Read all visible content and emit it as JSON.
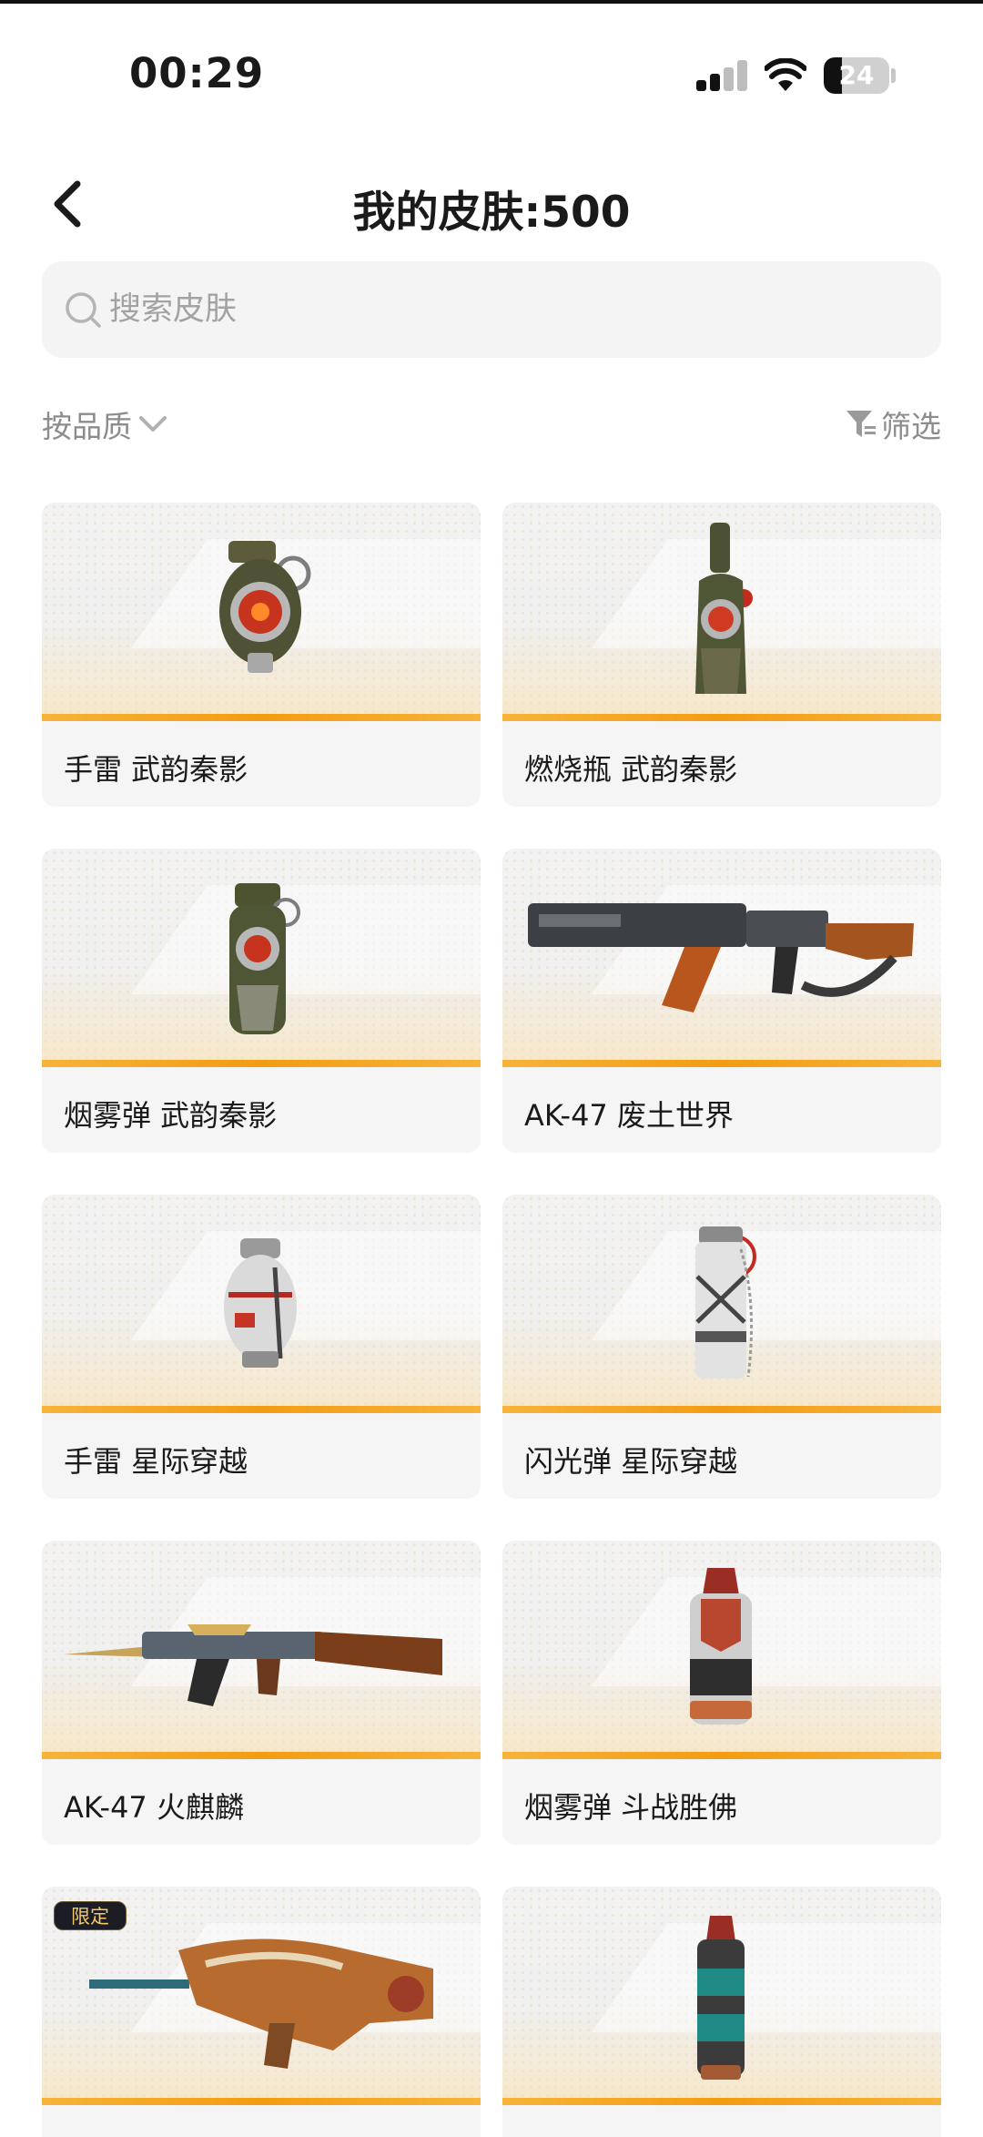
{
  "status_bar": {
    "time": "00:29",
    "battery": "24"
  },
  "header": {
    "title": "我的皮肤:500"
  },
  "search": {
    "placeholder": "搜索皮肤"
  },
  "toolbar": {
    "sort_label": "按品质",
    "filter_label": "筛选"
  },
  "colors": {
    "accent_bar": "#f39c12",
    "card_bg": "#f5f5f5",
    "badge_text": "#f2c96a"
  },
  "skins": [
    {
      "name": "手雷 武韵秦影",
      "icon": "grenade-icon"
    },
    {
      "name": "燃烧瓶 武韵秦影",
      "icon": "molotov-icon"
    },
    {
      "name": "烟雾弹 武韵秦影",
      "icon": "smoke-grenade-icon"
    },
    {
      "name": "AK-47 废土世界",
      "icon": "rifle-icon"
    },
    {
      "name": "手雷 星际穿越",
      "icon": "grenade-icon"
    },
    {
      "name": "闪光弹 星际穿越",
      "icon": "flashbang-icon"
    },
    {
      "name": "AK-47 火麒麟",
      "icon": "rifle-icon"
    },
    {
      "name": "烟雾弹 斗战胜佛",
      "icon": "smoke-grenade-icon"
    },
    {
      "name": "",
      "icon": "rifle-icon",
      "badge": "限定"
    },
    {
      "name": "",
      "icon": "grenade-icon"
    }
  ]
}
